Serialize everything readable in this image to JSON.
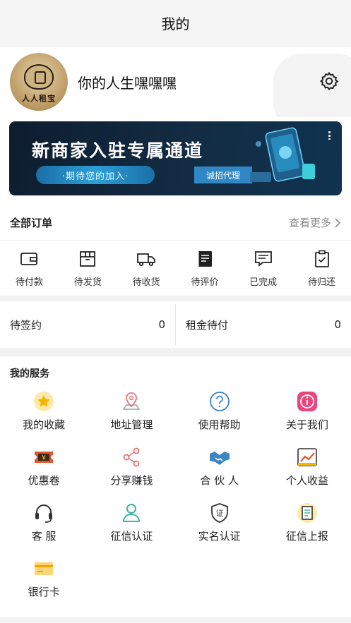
{
  "header": {
    "title": "我的"
  },
  "profile": {
    "avatar_text": "人人租宝",
    "username": "你的人生嘿嘿嘿",
    "settings_icon": "gear-icon"
  },
  "banner": {
    "title": "新商家入驻专属通道",
    "subtitle": "·期待您的加入·",
    "tag": "诚招代理"
  },
  "orders": {
    "title": "全部订单",
    "more": "查看更多",
    "items": [
      {
        "label": "待付款",
        "icon": "wallet-icon"
      },
      {
        "label": "待发货",
        "icon": "package-icon"
      },
      {
        "label": "待收货",
        "icon": "truck-icon"
      },
      {
        "label": "待评价",
        "icon": "book-icon"
      },
      {
        "label": "已完成",
        "icon": "message-icon"
      },
      {
        "label": "待归还",
        "icon": "clipboard-check-icon"
      }
    ]
  },
  "pending": {
    "sign": {
      "label": "待签约",
      "count": "0"
    },
    "rent": {
      "label": "租金待付",
      "count": "0"
    }
  },
  "services": {
    "title": "我的服务",
    "items": [
      {
        "label": "我的收藏",
        "icon": "star-icon",
        "color": "#f5b400"
      },
      {
        "label": "地址管理",
        "icon": "location-icon",
        "color": "#e57373"
      },
      {
        "label": "使用帮助",
        "icon": "help-icon",
        "color": "#3d86c6"
      },
      {
        "label": "关于我们",
        "icon": "info-icon",
        "color": "#e8467c"
      },
      {
        "label": "优惠卷",
        "icon": "coupon-icon",
        "color": "#e4572e"
      },
      {
        "label": "分享赚钱",
        "icon": "share-icon",
        "color": "#e57373"
      },
      {
        "label": "合 伙 人",
        "icon": "handshake-icon",
        "color": "#3d86c6"
      },
      {
        "label": "个人收益",
        "icon": "chart-icon",
        "color": "#e4572e"
      },
      {
        "label": "客 服",
        "icon": "headset-icon",
        "color": "#333333"
      },
      {
        "label": "征信认证",
        "icon": "user-icon",
        "color": "#3fb59e"
      },
      {
        "label": "实名认证",
        "icon": "shield-icon",
        "color": "#333333"
      },
      {
        "label": "征信上报",
        "icon": "report-icon",
        "color": "#f5b400"
      },
      {
        "label": "银行卡",
        "icon": "bank-card-icon",
        "color": "#f5b400"
      }
    ]
  }
}
